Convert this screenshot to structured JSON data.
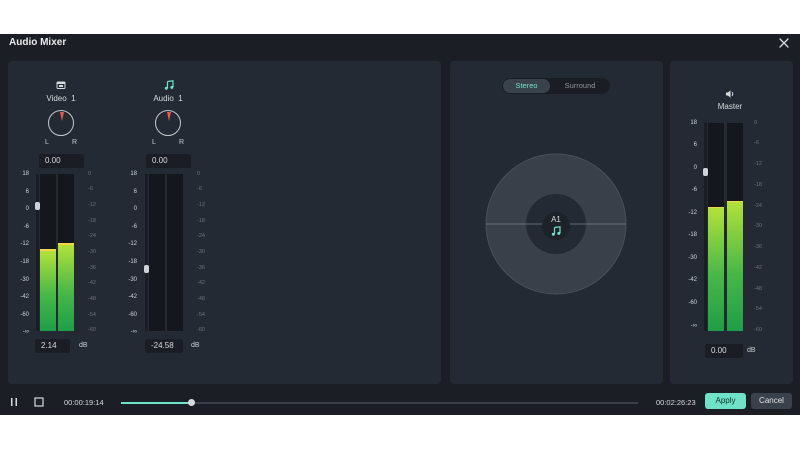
{
  "window": {
    "title": "Audio Mixer"
  },
  "scale_left": [
    "18",
    "6",
    "0",
    "-6",
    "-12",
    "-18",
    "-30",
    "-42",
    "-60",
    "-∞"
  ],
  "scale_right": [
    "0",
    "-6",
    "-12",
    "-18",
    "-24",
    "-30",
    "-36",
    "-42",
    "-48",
    "-54",
    "-60"
  ],
  "db_unit": "dB",
  "pan_labels": {
    "left": "L",
    "right": "R"
  },
  "tracks": [
    {
      "name": "Video  1",
      "icon": "video-track-icon",
      "pan_value": "0.00",
      "gain_value": "2.14",
      "meter_levels": [
        0.51,
        0.55
      ],
      "fader_level": 0.79
    },
    {
      "name": "Audio  1",
      "icon": "music-note-icon",
      "pan_value": "0.00",
      "gain_value": "-24.58",
      "meter_levels": [
        0,
        0
      ],
      "fader_level": 0.39
    }
  ],
  "panner": {
    "mode_tabs": [
      {
        "label": "Stereo",
        "active": true
      },
      {
        "label": "Surround",
        "active": false
      }
    ],
    "source_label": "A1",
    "source_icon": "music-note-icon"
  },
  "master": {
    "name": "Master",
    "icon": "speaker-icon",
    "gain_value": "0.00",
    "meter_levels": [
      0.59,
      0.62
    ],
    "fader_level": 0.78
  },
  "transport": {
    "current_time": "00:00:19:14",
    "total_time": "00:02:26:23",
    "progress": 0.136,
    "apply_label": "Apply",
    "cancel_label": "Cancel"
  },
  "colors": {
    "accent": "#6fe3c7",
    "panel": "#242a33",
    "background": "#1b1f25",
    "pan_indicator": "#f0574b"
  }
}
